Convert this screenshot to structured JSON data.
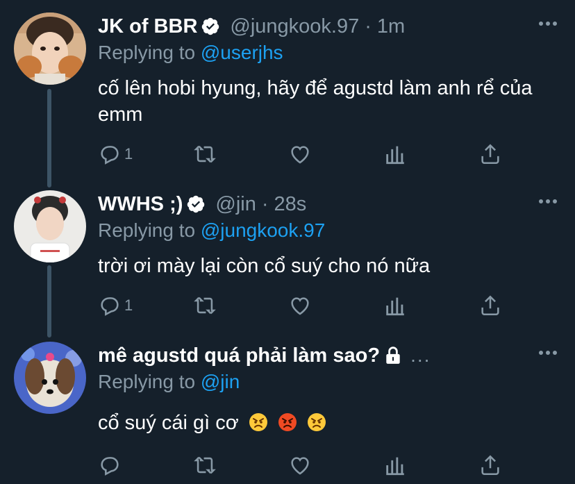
{
  "tweets": [
    {
      "name": "JK of BBR",
      "handle": "@jungkook.97",
      "separator": "·",
      "time": "1m",
      "replying_label": "Replying to",
      "replying_to": "@userjhs",
      "text": "cố lên hobi hyung, hãy để agustd làm anh rể của emm",
      "reply_count": "1",
      "verified": true
    },
    {
      "name": "WWHS ;)",
      "handle": "@jin",
      "separator": "·",
      "time": "28s",
      "replying_label": "Replying to",
      "replying_to": "@jungkook.97",
      "text": "trời ơi mày lại còn cổ suý cho nó nữa",
      "reply_count": "1",
      "verified": true
    },
    {
      "name": "mê agustd quá phải làm sao?",
      "handle": "",
      "separator": "",
      "time": "",
      "trail": "...",
      "replying_label": "Replying to",
      "replying_to": "@jin",
      "text": "cổ suý cái gì cơ",
      "reply_count": "",
      "verified": false,
      "protected": true
    }
  ],
  "colors": {
    "background": "#15202b",
    "text": "#ffffff",
    "secondary": "#8899a6",
    "link": "#1da1f2",
    "thread_line": "#3d5466"
  },
  "icons": [
    "reply-icon",
    "retweet-icon",
    "like-icon",
    "analytics-icon",
    "share-icon",
    "more-icon",
    "verified-badge-icon",
    "lock-icon",
    "angry-face-emoji"
  ]
}
